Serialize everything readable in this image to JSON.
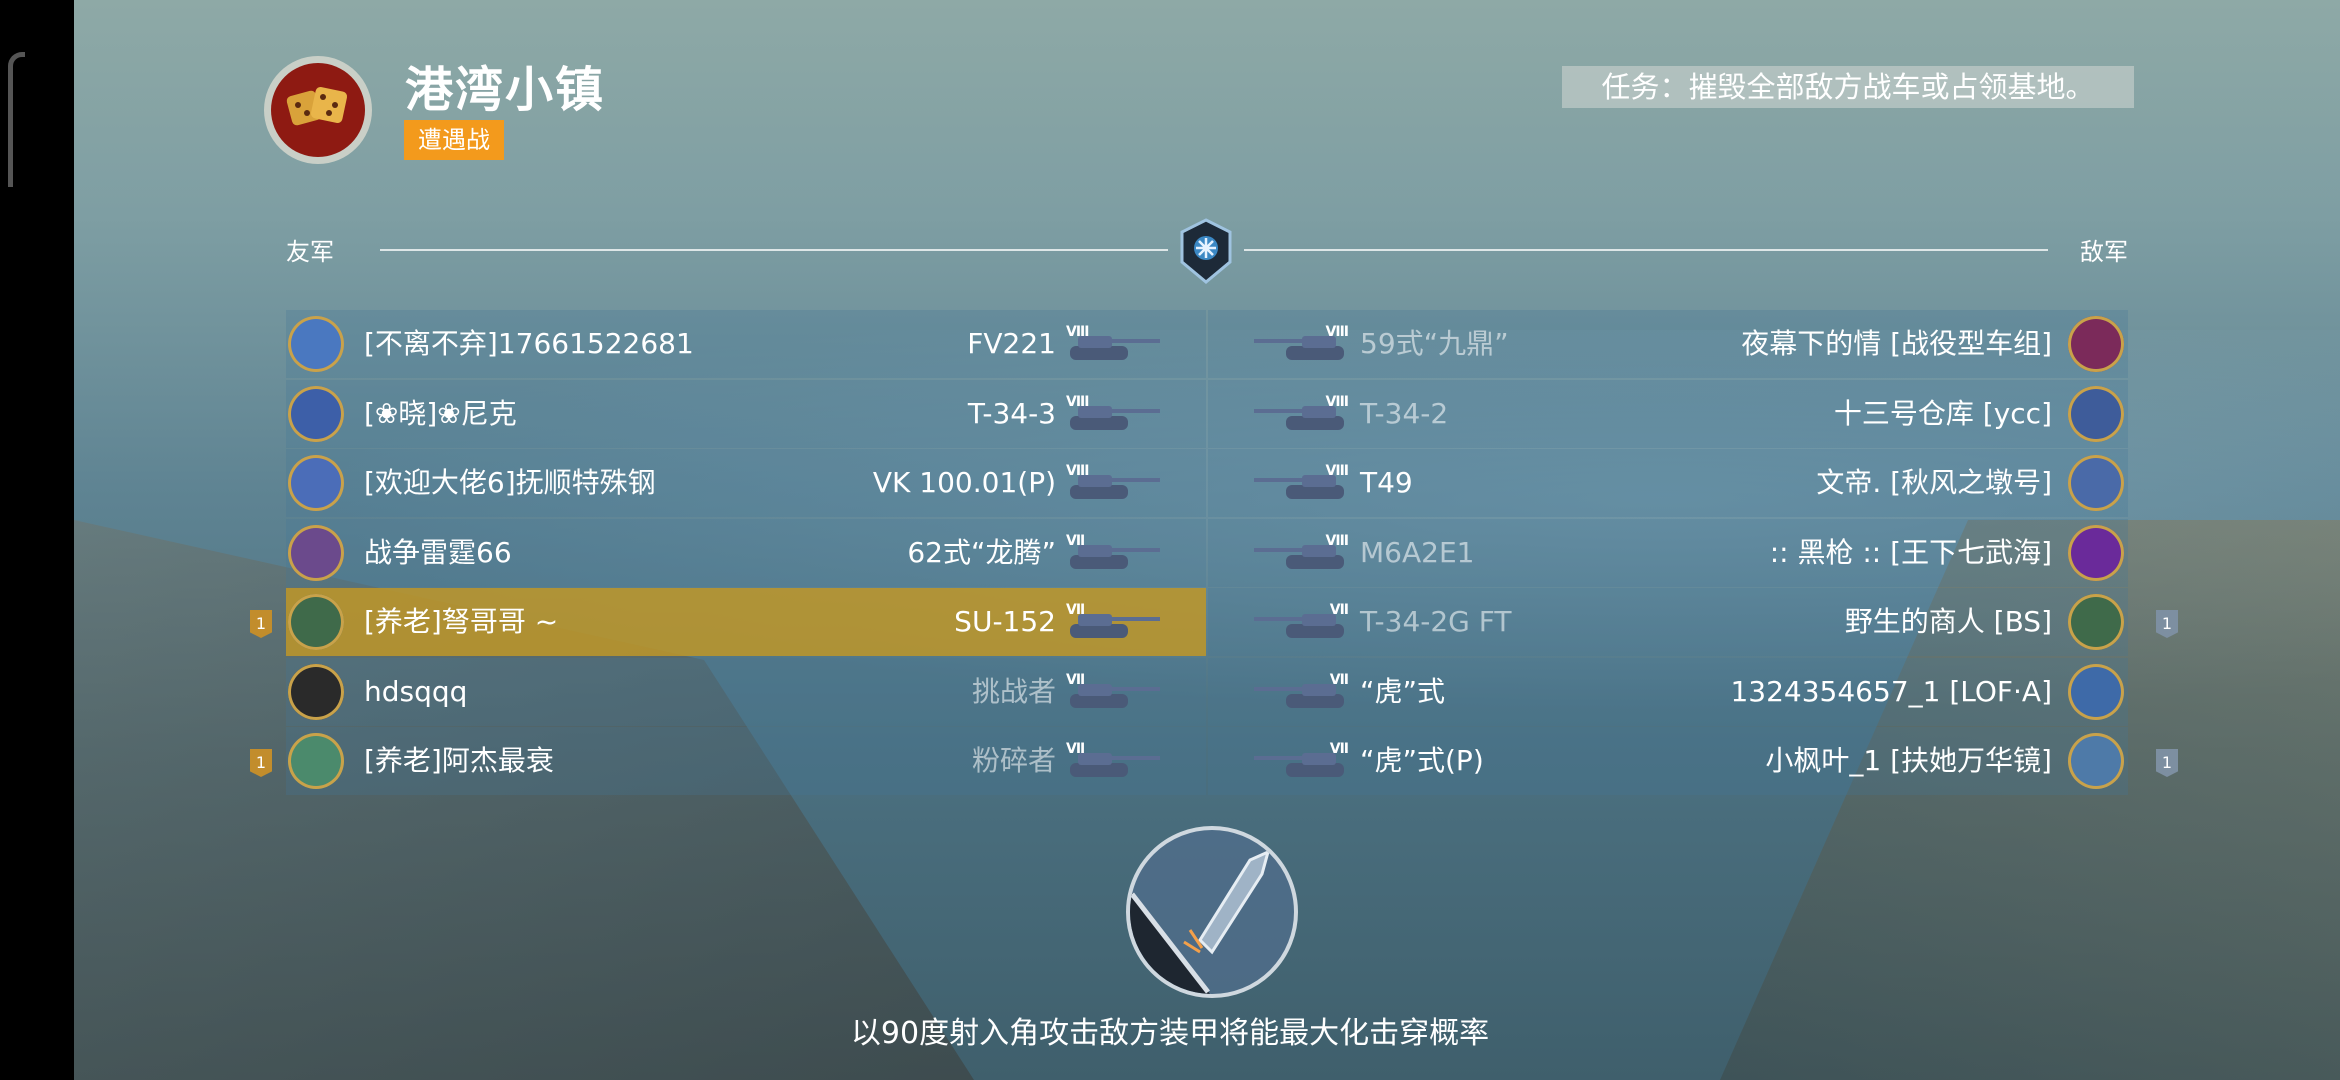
{
  "map": {
    "title": "港湾小镇",
    "mode": "遭遇战",
    "mission": "任务：摧毁全部敌方战车或占领基地。",
    "icon": "dice-icon"
  },
  "teams": {
    "ally_label": "友军",
    "enemy_label": "敌军"
  },
  "allies": [
    {
      "player": "[不离不弃]17661522681",
      "tank": "FV221",
      "tier": "VIII",
      "dim": false,
      "platoon": "",
      "avatar_color": "#4a78c0"
    },
    {
      "player": "[❀晓]❀尼克",
      "tank": "T-34-3",
      "tier": "VIII",
      "dim": false,
      "platoon": "",
      "avatar_color": "#3d5fa8"
    },
    {
      "player": "[欢迎大佬6]抚顺特殊钢",
      "tank": "VK 100.01(P)",
      "tier": "VIII",
      "dim": false,
      "platoon": "",
      "avatar_color": "#4b6db8"
    },
    {
      "player": "战争雷霆66",
      "tank": "62式“龙腾”",
      "tier": "VII",
      "dim": false,
      "platoon": "",
      "avatar_color": "#6b4a8c"
    },
    {
      "player": "[养老]弩哥哥 ~",
      "tank": "SU-152",
      "tier": "VII",
      "dim": false,
      "platoon": "1",
      "avatar_color": "#3f6a4a",
      "me": true
    },
    {
      "player": "hdsqqq",
      "tank": "挑战者",
      "tier": "VII",
      "dim": true,
      "platoon": "",
      "avatar_color": "#2a2a2a"
    },
    {
      "player": "[养老]阿杰最衰",
      "tank": "粉碎者",
      "tier": "VII",
      "dim": true,
      "platoon": "1",
      "avatar_color": "#4b8a6c"
    }
  ],
  "enemies": [
    {
      "player": "夜幕下的情 [战役型车组]",
      "tank": "59式“九鼎”",
      "tier": "VIII",
      "dim": true,
      "platoon": "",
      "avatar_color": "#7b2a5a"
    },
    {
      "player": "十三号仓库 [ycc]",
      "tank": "T-34-2",
      "tier": "VIII",
      "dim": true,
      "platoon": "",
      "avatar_color": "#3e5c9a"
    },
    {
      "player": "文帝. [秋风之墩号]",
      "tank": "T49",
      "tier": "VIII",
      "dim": false,
      "platoon": "",
      "avatar_color": "#4a6aa8"
    },
    {
      "player": ":: 黑枪 :: [王下七武海]",
      "tank": "M6A2E1",
      "tier": "VIII",
      "dim": true,
      "platoon": "",
      "avatar_color": "#6a2a9a"
    },
    {
      "player": "野生的商人 [BS]",
      "tank": "T-34-2G FT",
      "tier": "VII",
      "dim": true,
      "platoon": "1",
      "avatar_color": "#3f6a4a"
    },
    {
      "player": "1324354657_1 [LOF·A]",
      "tank": "“虎”式",
      "tier": "VII",
      "dim": false,
      "platoon": "",
      "avatar_color": "#3e6aa8"
    },
    {
      "player": "小枫叶_1 [扶她万华镜]",
      "tank": "“虎”式(P)",
      "tier": "VII",
      "dim": false,
      "platoon": "1",
      "avatar_color": "#4e7aa8"
    }
  ],
  "tip": {
    "text": "以90度射入角攻击敌方装甲将能最大化击穿概率",
    "icon": "armor-penetration-icon"
  },
  "colors": {
    "mode_badge": "#f39a1c",
    "highlight_row": "#bf9a2c"
  }
}
